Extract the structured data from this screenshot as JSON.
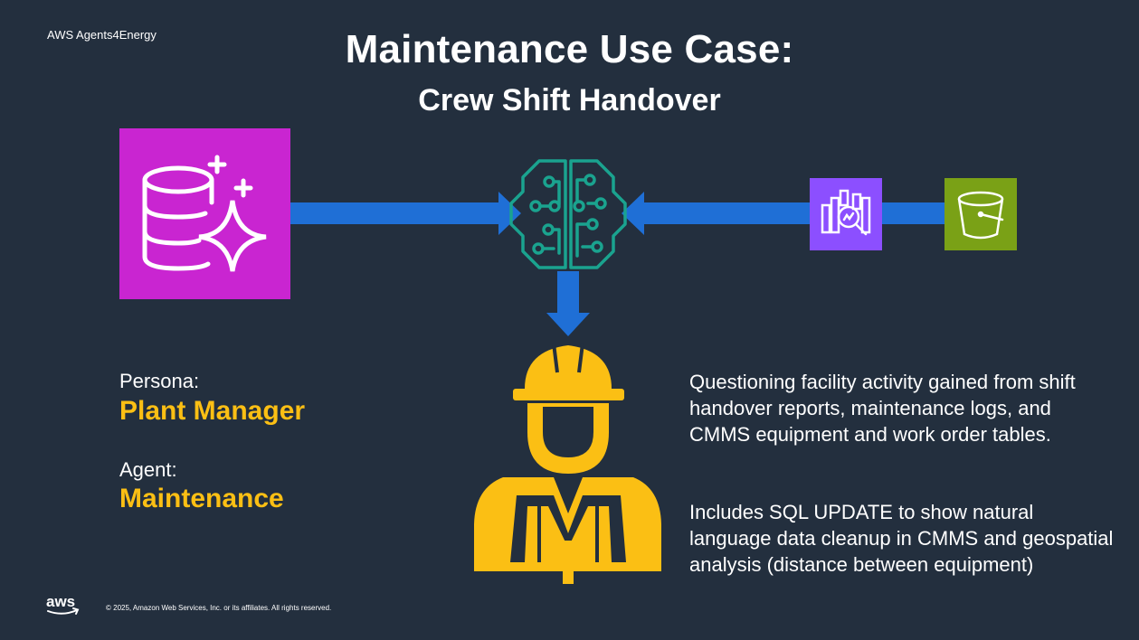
{
  "header": {
    "brand": "AWS Agents4Energy",
    "title": "Maintenance Use Case:",
    "subtitle": "Crew Shift Handover"
  },
  "icons": {
    "database": "database-sparkle-icon",
    "agent": "brain-circuit-icon",
    "analytics": "data-analytics-search-icon",
    "storage": "s3-bucket-icon",
    "person": "construction-worker-icon"
  },
  "colors": {
    "background": "#232f3e",
    "arrow": "#1f6fd6",
    "database_tile": "#c925d1",
    "analytics_tile": "#8c4fff",
    "storage_tile": "#7aa116",
    "brain": "#1aa38f",
    "worker": "#fbbf14",
    "accent_text": "#fbbf14"
  },
  "persona": {
    "label": "Persona:",
    "value": "Plant Manager"
  },
  "agent": {
    "label": "Agent:",
    "value": "Maintenance"
  },
  "description": {
    "paragraph_1": "Questioning facility activity gained from shift handover reports, maintenance logs, and CMMS equipment and work order tables.",
    "paragraph_2": "Includes SQL UPDATE to show natural language data cleanup in CMMS and geospatial analysis (distance between equipment)"
  },
  "footer": {
    "logo": "aws",
    "copyright": "© 2025, Amazon Web Services, Inc. or its affiliates. All rights reserved."
  }
}
